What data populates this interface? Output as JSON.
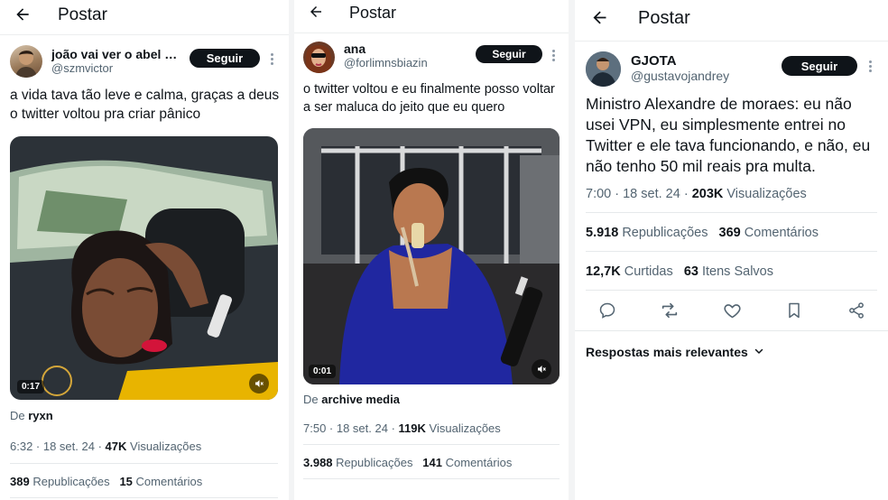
{
  "header": {
    "title": "Postar"
  },
  "post1": {
    "author_name": "joão vai ver o abel di...",
    "author_handle": "@szmvictor",
    "follow_label": "Seguir",
    "text": "a vida tava tão leve e calma, graças a deus o twitter voltou pra criar pânico",
    "video_duration": "0:17",
    "source_prefix": "De",
    "source_name": "ryxn",
    "time": "6:32 · 18 set. 24 ·",
    "views_count": "47K",
    "views_label": "Visualizações",
    "reposts_count": "389",
    "reposts_label": "Republicações",
    "comments_count": "15",
    "comments_label": "Comentários"
  },
  "post2": {
    "author_name": "ana",
    "author_handle": "@forlimnsbiazin",
    "follow_label": "Seguir",
    "text": "o twitter voltou e eu finalmente posso voltar a ser maluca do jeito que eu quero",
    "video_duration": "0:01",
    "source_prefix": "De",
    "source_name": "archive media",
    "time": "7:50 · 18 set. 24 ·",
    "views_count": "119K",
    "views_label": "Visualizações",
    "reposts_count": "3.988",
    "reposts_label": "Republicações",
    "comments_count": "141",
    "comments_label": "Comentários"
  },
  "post3": {
    "author_name": "GJOTA",
    "author_handle": "@gustavojandrey",
    "follow_label": "Seguir",
    "text": "Ministro Alexandre de moraes: eu não usei VPN, eu simplesmente entrei no Twitter e ele tava funcionando, e não, eu não tenho 50 mil reais pra multa.",
    "time": "7:00 · 18 set. 24 ·",
    "views_count": "203K",
    "views_label": "Visualizações",
    "reposts_count": "5.918",
    "reposts_label": "Republicações",
    "comments_count": "369",
    "comments_label": "Comentários",
    "likes_count": "12,7K",
    "likes_label": "Curtidas",
    "saves_count": "63",
    "saves_label": "Itens Salvos",
    "replies_sort_label": "Respostas mais relevantes"
  },
  "icons": [
    "back-arrow-icon",
    "more-vertical-icon",
    "mute-icon",
    "reply-icon",
    "repost-icon",
    "like-icon",
    "bookmark-icon",
    "share-icon",
    "chevron-down-icon"
  ]
}
